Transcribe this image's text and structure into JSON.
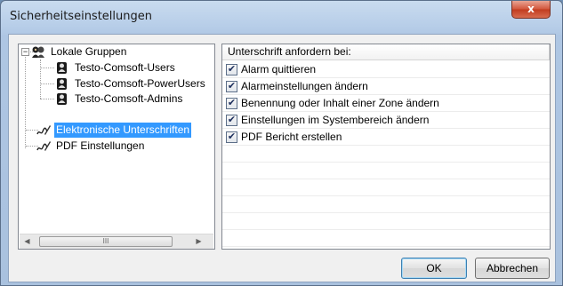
{
  "window": {
    "title": "Sicherheitseinstellungen",
    "close_label": "x"
  },
  "tree": {
    "root_expander": "−",
    "root_label": "Lokale Gruppen",
    "groups": [
      {
        "label": "Testo-Comsoft-Users"
      },
      {
        "label": "Testo-Comsoft-PowerUsers"
      },
      {
        "label": "Testo-Comsoft-Admins"
      }
    ],
    "items": [
      {
        "label": "Elektronische Unterschriften",
        "selected": true
      },
      {
        "label": "PDF Einstellungen",
        "selected": false
      }
    ],
    "scroll_left": "◀",
    "scroll_right": "▶",
    "scroll_grip": "III"
  },
  "list": {
    "header": "Unterschrift anfordern bei:",
    "rows": [
      {
        "label": "Alarm quittieren",
        "checked": true
      },
      {
        "label": "Alarmeinstellungen ändern",
        "checked": true
      },
      {
        "label": "Benennung oder Inhalt einer Zone ändern",
        "checked": true
      },
      {
        "label": "Einstellungen im Systembereich ändern",
        "checked": true
      },
      {
        "label": "PDF Bericht erstellen",
        "checked": true
      }
    ],
    "check_mark": "✔"
  },
  "buttons": {
    "ok": "OK",
    "cancel": "Abbrechen"
  },
  "colors": {
    "selection": "#3399ff",
    "close_button": "#c13c1f"
  }
}
